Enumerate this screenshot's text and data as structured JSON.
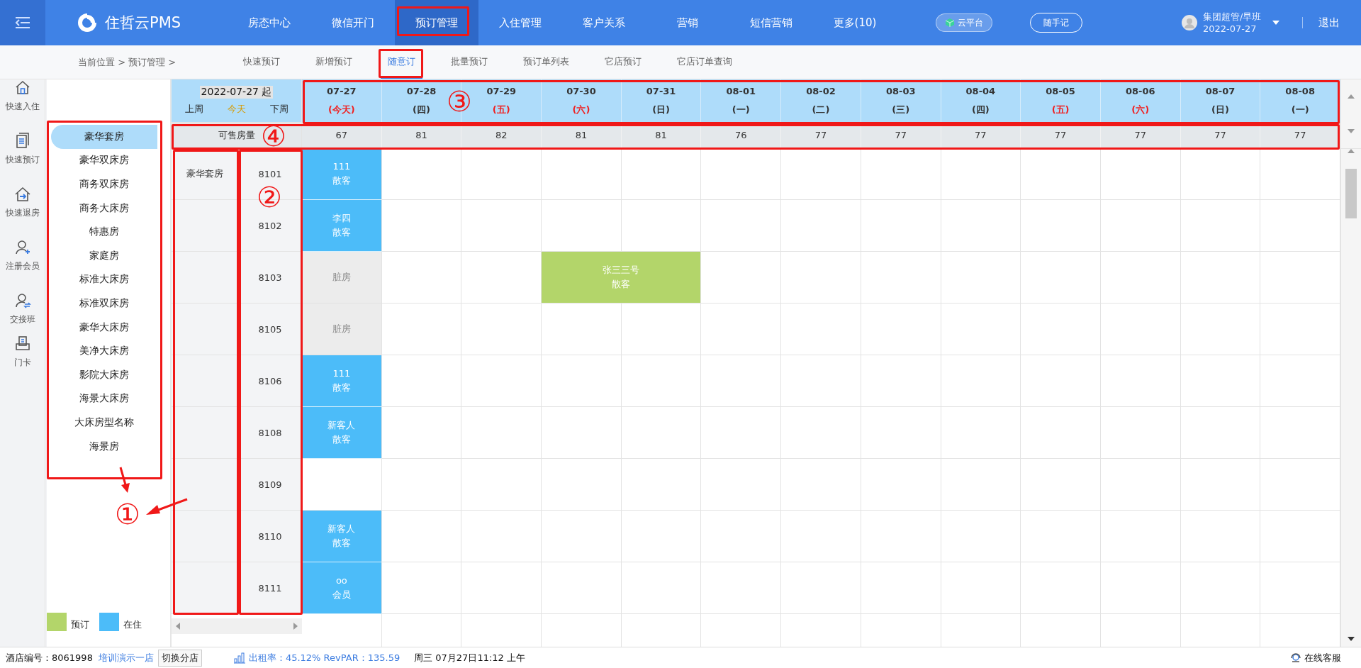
{
  "topbar": {
    "brand": "住哲云PMS",
    "nav": [
      {
        "label": "房态中心",
        "selected": false
      },
      {
        "label": "微信开门",
        "selected": false
      },
      {
        "label": "预订管理",
        "selected": true
      },
      {
        "label": "入住管理",
        "selected": false
      },
      {
        "label": "客户关系",
        "selected": false
      },
      {
        "label": "营销",
        "selected": false
      },
      {
        "label": "短信营销",
        "selected": false
      },
      {
        "label": "更多(10)",
        "selected": false
      }
    ],
    "cloud_button": "云平台",
    "note_button": "随手记",
    "user_name": "集团超管/早班",
    "user_date": "2022-07-27",
    "logout": "退出"
  },
  "breadcrumb": "当前位置 > 预订管理 >",
  "subtabs": [
    {
      "label": "快速预订",
      "selected": false
    },
    {
      "label": "新增预订",
      "selected": false
    },
    {
      "label": "随意订",
      "selected": true
    },
    {
      "label": "批量预订",
      "selected": false
    },
    {
      "label": "预订单列表",
      "selected": false
    },
    {
      "label": "它店预订",
      "selected": false
    },
    {
      "label": "它店订单查询",
      "selected": false
    }
  ],
  "sidebar": [
    {
      "label": "快速入住"
    },
    {
      "label": "快速预订"
    },
    {
      "label": "快速退房"
    },
    {
      "label": "注册会员"
    },
    {
      "label": "交接班"
    },
    {
      "label": "门卡"
    }
  ],
  "room_types": [
    {
      "label": "豪华套房",
      "selected": true
    },
    {
      "label": "豪华双床房",
      "selected": false
    },
    {
      "label": "商务双床房",
      "selected": false
    },
    {
      "label": "商务大床房",
      "selected": false
    },
    {
      "label": "特惠房",
      "selected": false
    },
    {
      "label": "家庭房",
      "selected": false
    },
    {
      "label": "标准大床房",
      "selected": false
    },
    {
      "label": "标准双床房",
      "selected": false
    },
    {
      "label": "豪华大床房",
      "selected": false
    },
    {
      "label": "美净大床房",
      "selected": false
    },
    {
      "label": "影院大床房",
      "selected": false
    },
    {
      "label": "海景大床房",
      "selected": false
    },
    {
      "label": "大床房型名称",
      "selected": false
    },
    {
      "label": "海景房",
      "selected": false
    }
  ],
  "legend": [
    {
      "label": "预订",
      "color": "#b3d56a"
    },
    {
      "label": "在住",
      "color": "#4cbcf9"
    }
  ],
  "grid": {
    "start_date": "2022-07-27 起",
    "prev_week": "上周",
    "today": "今天",
    "next_week": "下周",
    "available_label": "可售房量",
    "days": [
      {
        "date": "07-27",
        "weekday": "(今天)",
        "highlight": true,
        "available": "67"
      },
      {
        "date": "07-28",
        "weekday": "(四)",
        "highlight": false,
        "available": "81"
      },
      {
        "date": "07-29",
        "weekday": "(五)",
        "highlight": true,
        "available": "82"
      },
      {
        "date": "07-30",
        "weekday": "(六)",
        "highlight": true,
        "available": "81"
      },
      {
        "date": "07-31",
        "weekday": "(日)",
        "highlight": false,
        "available": "81"
      },
      {
        "date": "08-01",
        "weekday": "(一)",
        "highlight": false,
        "available": "76"
      },
      {
        "date": "08-02",
        "weekday": "(二)",
        "highlight": false,
        "available": "77"
      },
      {
        "date": "08-03",
        "weekday": "(三)",
        "highlight": false,
        "available": "77"
      },
      {
        "date": "08-04",
        "weekday": "(四)",
        "highlight": false,
        "available": "77"
      },
      {
        "date": "08-05",
        "weekday": "(五)",
        "highlight": true,
        "available": "77"
      },
      {
        "date": "08-06",
        "weekday": "(六)",
        "highlight": true,
        "available": "77"
      },
      {
        "date": "08-07",
        "weekday": "(日)",
        "highlight": false,
        "available": "77"
      },
      {
        "date": "08-08",
        "weekday": "(一)",
        "highlight": false,
        "available": "77"
      }
    ],
    "rows": [
      {
        "room_type": "豪华套房",
        "room": "8101",
        "cells": [
          {
            "kind": "occupied",
            "name": "111",
            "guest": "散客"
          },
          {
            "kind": "empty"
          },
          {
            "kind": "empty"
          },
          {
            "kind": "empty"
          },
          {
            "kind": "empty"
          },
          {
            "kind": "empty"
          },
          {
            "kind": "empty"
          },
          {
            "kind": "empty"
          },
          {
            "kind": "empty"
          },
          {
            "kind": "empty"
          },
          {
            "kind": "empty"
          },
          {
            "kind": "empty"
          },
          {
            "kind": "empty"
          }
        ]
      },
      {
        "room": "8102",
        "cells": [
          {
            "kind": "occupied",
            "name": "李四",
            "guest": "散客"
          },
          {
            "kind": "empty"
          },
          {
            "kind": "empty"
          },
          {
            "kind": "empty"
          },
          {
            "kind": "empty"
          },
          {
            "kind": "empty"
          },
          {
            "kind": "empty"
          },
          {
            "kind": "empty"
          },
          {
            "kind": "empty"
          },
          {
            "kind": "empty"
          },
          {
            "kind": "empty"
          },
          {
            "kind": "empty"
          },
          {
            "kind": "empty"
          }
        ]
      },
      {
        "room": "8103",
        "cells": [
          {
            "kind": "dirty",
            "label": "脏房"
          },
          {
            "kind": "empty"
          },
          {
            "kind": "empty"
          },
          {
            "kind": "reserved",
            "name": "张三三号",
            "guest": "散客"
          },
          {
            "kind": "reserved_cont"
          },
          {
            "kind": "empty"
          },
          {
            "kind": "empty"
          },
          {
            "kind": "empty"
          },
          {
            "kind": "empty"
          },
          {
            "kind": "empty"
          },
          {
            "kind": "empty"
          },
          {
            "kind": "empty"
          },
          {
            "kind": "empty"
          }
        ]
      },
      {
        "room": "8105",
        "cells": [
          {
            "kind": "dirty",
            "label": "脏房"
          },
          {
            "kind": "empty"
          },
          {
            "kind": "empty"
          },
          {
            "kind": "empty"
          },
          {
            "kind": "empty"
          },
          {
            "kind": "empty"
          },
          {
            "kind": "empty"
          },
          {
            "kind": "empty"
          },
          {
            "kind": "empty"
          },
          {
            "kind": "empty"
          },
          {
            "kind": "empty"
          },
          {
            "kind": "empty"
          },
          {
            "kind": "empty"
          }
        ]
      },
      {
        "room": "8106",
        "cells": [
          {
            "kind": "occupied",
            "name": "111",
            "guest": "散客"
          },
          {
            "kind": "empty"
          },
          {
            "kind": "empty"
          },
          {
            "kind": "empty"
          },
          {
            "kind": "empty"
          },
          {
            "kind": "empty"
          },
          {
            "kind": "empty"
          },
          {
            "kind": "empty"
          },
          {
            "kind": "empty"
          },
          {
            "kind": "empty"
          },
          {
            "kind": "empty"
          },
          {
            "kind": "empty"
          },
          {
            "kind": "empty"
          }
        ]
      },
      {
        "room": "8108",
        "cells": [
          {
            "kind": "occupied",
            "name": "新客人",
            "guest": "散客"
          },
          {
            "kind": "empty"
          },
          {
            "kind": "empty"
          },
          {
            "kind": "empty"
          },
          {
            "kind": "empty"
          },
          {
            "kind": "empty"
          },
          {
            "kind": "empty"
          },
          {
            "kind": "empty"
          },
          {
            "kind": "empty"
          },
          {
            "kind": "empty"
          },
          {
            "kind": "empty"
          },
          {
            "kind": "empty"
          },
          {
            "kind": "empty"
          }
        ]
      },
      {
        "room": "8109",
        "cells": [
          {
            "kind": "empty"
          },
          {
            "kind": "empty"
          },
          {
            "kind": "empty"
          },
          {
            "kind": "empty"
          },
          {
            "kind": "empty"
          },
          {
            "kind": "empty"
          },
          {
            "kind": "empty"
          },
          {
            "kind": "empty"
          },
          {
            "kind": "empty"
          },
          {
            "kind": "empty"
          },
          {
            "kind": "empty"
          },
          {
            "kind": "empty"
          },
          {
            "kind": "empty"
          }
        ]
      },
      {
        "room": "8110",
        "cells": [
          {
            "kind": "occupied",
            "name": "新客人",
            "guest": "散客"
          },
          {
            "kind": "empty"
          },
          {
            "kind": "empty"
          },
          {
            "kind": "empty"
          },
          {
            "kind": "empty"
          },
          {
            "kind": "empty"
          },
          {
            "kind": "empty"
          },
          {
            "kind": "empty"
          },
          {
            "kind": "empty"
          },
          {
            "kind": "empty"
          },
          {
            "kind": "empty"
          },
          {
            "kind": "empty"
          },
          {
            "kind": "empty"
          }
        ]
      },
      {
        "room": "8111",
        "cells": [
          {
            "kind": "occupied",
            "name": "oo",
            "guest": "会员"
          },
          {
            "kind": "empty"
          },
          {
            "kind": "empty"
          },
          {
            "kind": "empty"
          },
          {
            "kind": "empty"
          },
          {
            "kind": "empty"
          },
          {
            "kind": "empty"
          },
          {
            "kind": "empty"
          },
          {
            "kind": "empty"
          },
          {
            "kind": "empty"
          },
          {
            "kind": "empty"
          },
          {
            "kind": "empty"
          },
          {
            "kind": "empty"
          }
        ]
      }
    ]
  },
  "status_bar": {
    "hotel_id": "酒店编号：8061998",
    "hotel_name": "培训演示一店",
    "switch_button": "切换分店",
    "occupancy": "出租率：45.12% RevPAR：135.59",
    "datetime": "周三 07月27日11:12 上午",
    "support": "在线客服"
  },
  "annotations": [
    {
      "label": "①"
    },
    {
      "label": "②"
    },
    {
      "label": "③"
    },
    {
      "label": "④"
    }
  ]
}
